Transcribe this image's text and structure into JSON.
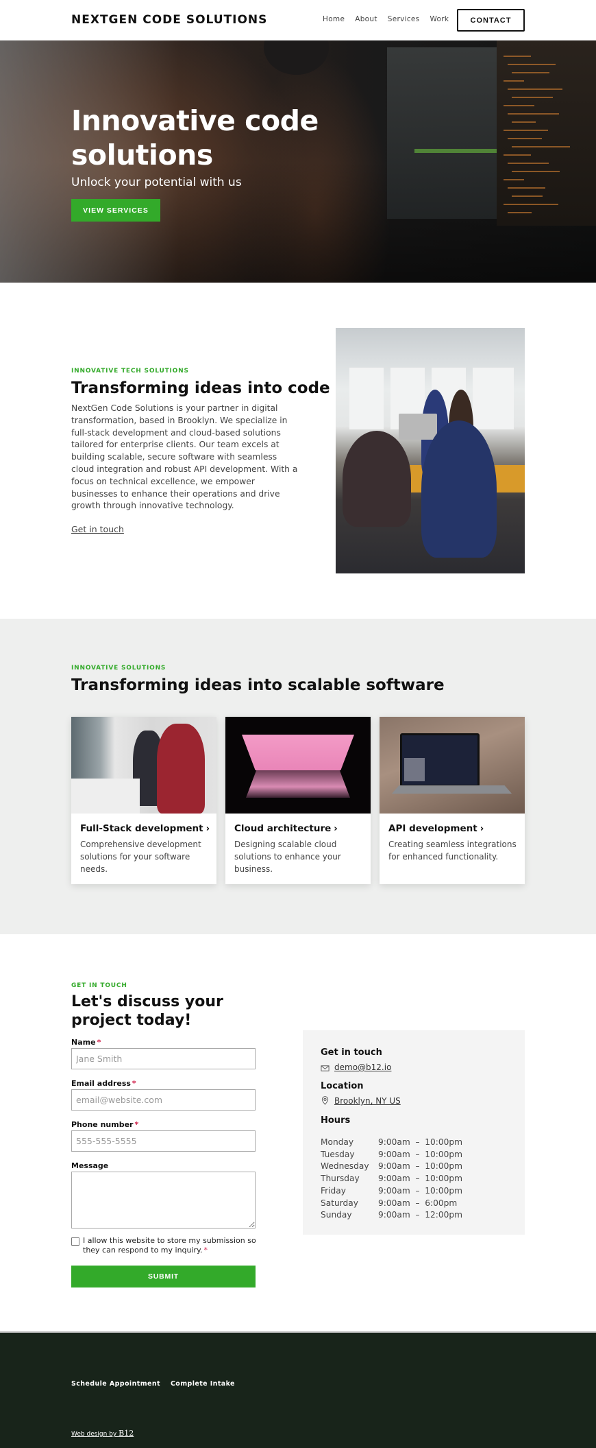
{
  "header": {
    "logo": "NEXTGEN CODE SOLUTIONS",
    "nav": [
      {
        "label": "Home"
      },
      {
        "label": "About"
      },
      {
        "label": "Services"
      },
      {
        "label": "Work"
      }
    ],
    "contact_button": "CONTACT"
  },
  "hero": {
    "title": "Innovative code solutions",
    "subtitle": "Unlock your potential with us",
    "button": "VIEW SERVICES"
  },
  "about": {
    "eyebrow": "INNOVATIVE TECH SOLUTIONS",
    "title": "Transforming ideas into code",
    "body": "NextGen Code Solutions is your partner in digital transformation, based in Brooklyn. We specialize in full-stack development and cloud-based solutions tailored for enterprise clients. Our team excels at building scalable, secure software with seamless cloud integration and robust API development. With a focus on technical excellence, we empower businesses to enhance their operations and drive growth through innovative technology.",
    "link": "Get in touch",
    "image_alt": "team-collaborating-in-office-photo"
  },
  "services": {
    "eyebrow": "INNOVATIVE SOLUTIONS",
    "title": "Transforming ideas into scalable software",
    "cards": [
      {
        "title": "Full-Stack development",
        "description": "Comprehensive development solutions for your software needs.",
        "image": "developers-at-computer-photo"
      },
      {
        "title": "Cloud architecture",
        "description": "Designing scalable cloud solutions to enhance your business.",
        "image": "glowing-pink-laptop-photo"
      },
      {
        "title": "API development",
        "description": "Creating seamless integrations for enhanced functionality.",
        "image": "laptop-with-code-editor-photo"
      }
    ],
    "chevron": "›"
  },
  "contact": {
    "eyebrow": "GET IN TOUCH",
    "title": "Let's discuss your project today!",
    "required_mark": "*",
    "fields": {
      "name": {
        "label": "Name",
        "placeholder": "Jane Smith",
        "value": ""
      },
      "email": {
        "label": "Email address",
        "placeholder": "email@website.com",
        "value": ""
      },
      "phone": {
        "label": "Phone number",
        "placeholder": "555-555-5555",
        "value": ""
      },
      "message": {
        "label": "Message",
        "value": ""
      }
    },
    "consent": "I allow this website to store my submission so they can respond to my inquiry.",
    "consent_checked": false,
    "submit": "SUBMIT",
    "info": {
      "get_in_touch_heading": "Get in touch",
      "email": "demo@b12.io",
      "location_heading": "Location",
      "location": "Brooklyn, NY US",
      "hours_heading": "Hours",
      "hours": [
        {
          "day": "Monday",
          "time": "9:00am  –  10:00pm"
        },
        {
          "day": "Tuesday",
          "time": "9:00am  –  10:00pm"
        },
        {
          "day": "Wednesday",
          "time": "9:00am  –  10:00pm"
        },
        {
          "day": "Thursday",
          "time": "9:00am  –  10:00pm"
        },
        {
          "day": "Friday",
          "time": "9:00am  –  10:00pm"
        },
        {
          "day": "Saturday",
          "time": "9:00am  –  6:00pm"
        },
        {
          "day": "Sunday",
          "time": "9:00am  –  12:00pm"
        }
      ]
    }
  },
  "footer": {
    "links": [
      {
        "label": "Schedule Appointment"
      },
      {
        "label": "Complete Intake"
      }
    ],
    "credit_prefix": "Web design by ",
    "credit_brand": "B12"
  },
  "colors": {
    "accent_green": "#33aa2a",
    "footer_bg": "#18241a",
    "section_gray": "#eeefee",
    "panel_gray": "#f4f4f4",
    "required_red": "#d0204a"
  }
}
